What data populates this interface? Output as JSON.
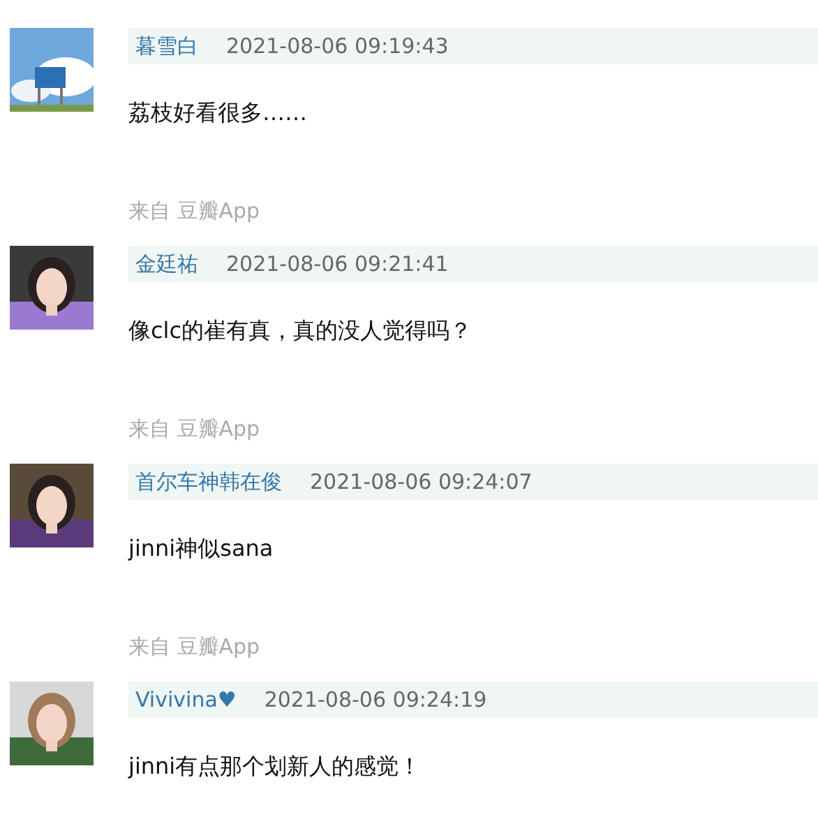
{
  "comments": [
    {
      "author": "暮雪白",
      "time": "2021-08-06 09:19:43",
      "text": "荔枝好看很多……",
      "source": "来自 豆瓣App"
    },
    {
      "author": "金廷祐",
      "time": "2021-08-06 09:21:41",
      "text": "像clc的崔有真，真的没人觉得吗？",
      "source": "来自 豆瓣App"
    },
    {
      "author": "首尔车神韩在俊",
      "time": "2021-08-06 09:24:07",
      "text": "jinni神似sana",
      "source": "来自 豆瓣App"
    },
    {
      "author": "Vivivina♥",
      "time": "2021-08-06 09:24:19",
      "text": "jinni有点那个划新人的感觉！"
    }
  ]
}
